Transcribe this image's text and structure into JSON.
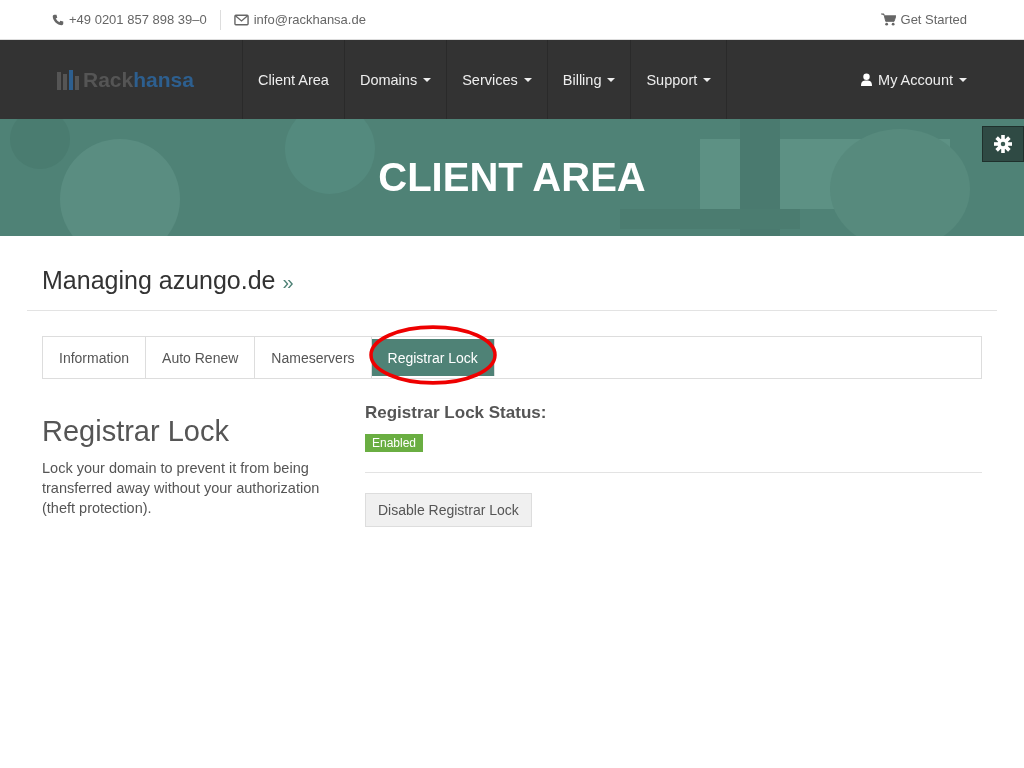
{
  "top_bar": {
    "phone": "+49 0201 857 898 39–0",
    "email": "info@rackhansa.de",
    "cart_link": "Get Started"
  },
  "logo": {
    "part_1": "Rack",
    "part_2": "hansa"
  },
  "nav": {
    "items": [
      {
        "label": "Client Area",
        "dropdown": false
      },
      {
        "label": "Domains",
        "dropdown": true
      },
      {
        "label": "Services",
        "dropdown": true
      },
      {
        "label": "Billing",
        "dropdown": true
      },
      {
        "label": "Support",
        "dropdown": true
      }
    ],
    "account": {
      "label": "My Account",
      "dropdown": true
    }
  },
  "hero": {
    "title": "CLIENT AREA"
  },
  "page_title": {
    "text": "Managing azungo.de",
    "link": "»"
  },
  "tabs": [
    {
      "label": "Information",
      "selected": false,
      "circled": false
    },
    {
      "label": "Auto Renew",
      "selected": false,
      "circled": false
    },
    {
      "label": "Nameservers",
      "selected": false,
      "circled": false
    },
    {
      "label": "Registrar Lock",
      "selected": true,
      "circled": true
    }
  ],
  "sidebar": {
    "title": "Registrar Lock",
    "description": "Lock your domain to prevent it from being transferred away without your authorization (theft protection)."
  },
  "status": {
    "heading": "Registrar Lock Status:",
    "badge": "Enabled",
    "enabled": true
  },
  "button": "Disable Registrar Lock"
}
